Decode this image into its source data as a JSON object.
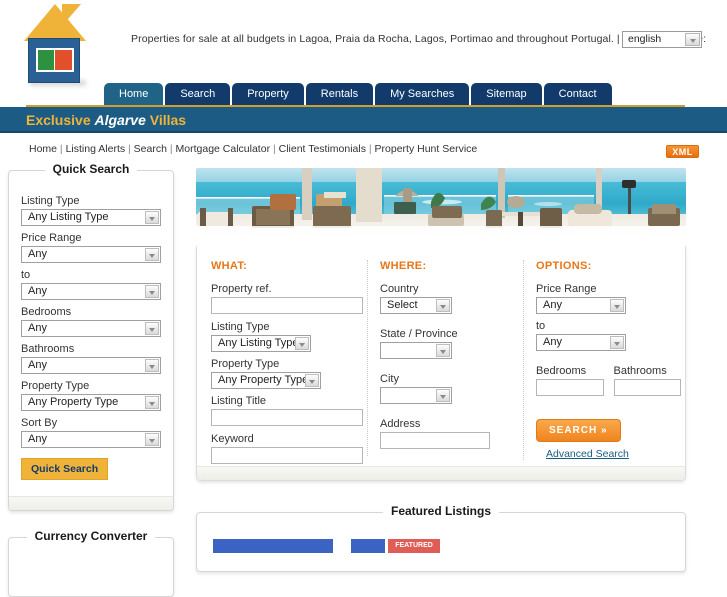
{
  "header": {
    "tagline": "Properties for sale at all budgets in Lagoa, Praia da Rocha, Lagos, Portimao and throughout Portugal. | Select Language:",
    "language_value": "english",
    "logo_name": "house-logo"
  },
  "nav": {
    "tabs": [
      {
        "label": "Home",
        "active": true
      },
      {
        "label": "Search",
        "active": false
      },
      {
        "label": "Property",
        "active": false
      },
      {
        "label": "Rentals",
        "active": false
      },
      {
        "label": "My Searches",
        "active": false
      },
      {
        "label": "Sitemap",
        "active": false
      },
      {
        "label": "Contact",
        "active": false
      }
    ]
  },
  "brand": {
    "word1": "Exclusive",
    "word2": "Algarve",
    "word3": "Villas"
  },
  "subnav": {
    "items": [
      "Home",
      "Listing Alerts",
      "Search",
      "Mortgage Calculator",
      "Client Testimonials",
      "Property Hunt Service"
    ],
    "separator": " | ",
    "xml_label": "XML"
  },
  "quick_search": {
    "title": "Quick Search",
    "fields": [
      {
        "label": "Listing Type",
        "value": "Any Listing Type"
      },
      {
        "label": "Price Range",
        "value": "Any"
      },
      {
        "label": "to",
        "value": "Any"
      },
      {
        "label": "Bedrooms",
        "value": "Any"
      },
      {
        "label": "Bathrooms",
        "value": "Any"
      },
      {
        "label": "Property Type",
        "value": "Any Property Type"
      },
      {
        "label": "Sort By",
        "value": "Any"
      }
    ],
    "button_label": "Quick Search"
  },
  "currency_converter": {
    "title": "Currency Converter"
  },
  "search_form": {
    "what": {
      "heading": "WHAT:",
      "property_ref_label": "Property ref.",
      "property_ref_value": "",
      "listing_type_label": "Listing Type",
      "listing_type_value": "Any Listing Type",
      "property_type_label": "Property Type",
      "property_type_value": "Any Property Type",
      "listing_title_label": "Listing Title",
      "listing_title_value": "",
      "keyword_label": "Keyword",
      "keyword_value": ""
    },
    "where": {
      "heading": "WHERE:",
      "country_label": "Country",
      "country_value": "Select",
      "state_label": "State / Province",
      "state_value": "",
      "city_label": "City",
      "city_value": "",
      "address_label": "Address",
      "address_value": ""
    },
    "options": {
      "heading": "OPTIONS:",
      "price_range_label": "Price Range",
      "price_min_value": "Any",
      "to_label": "to",
      "price_max_value": "Any",
      "bedrooms_label": "Bedrooms",
      "bedrooms_value": "",
      "bathrooms_label": "Bathrooms",
      "bathrooms_value": "",
      "search_button": "SEARCH »",
      "advanced_link": "Advanced Search"
    }
  },
  "featured": {
    "title": "Featured Listings",
    "badge_label": "FEATURED"
  },
  "colors": {
    "navy": "#123A6B",
    "active_tab": "#1F6387",
    "band_blue": "#1C5C84",
    "gold": "#EFB33A",
    "orange": "#E8761A",
    "xml_orange": "#E86E10"
  }
}
